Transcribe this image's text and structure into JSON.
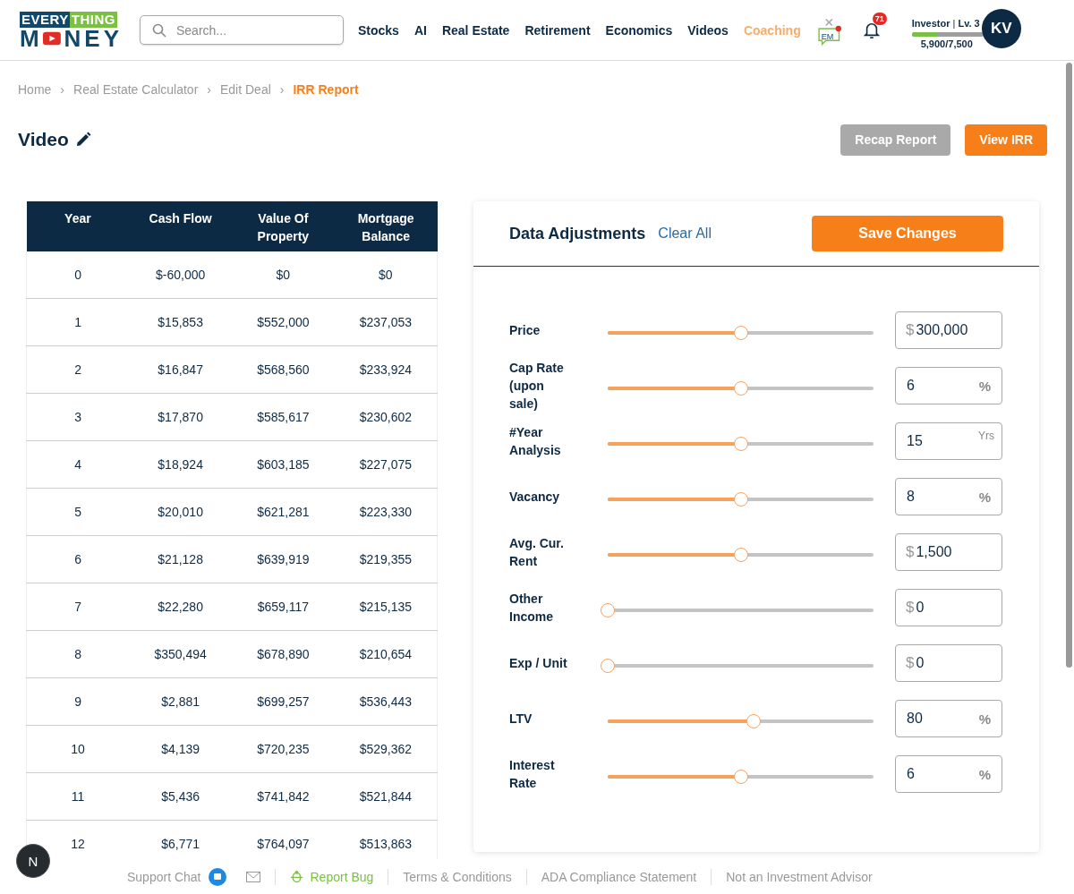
{
  "logo": {
    "top_left": "EVERY",
    "top_right": "THING",
    "bottom_left": "M",
    "bottom_right": "NEY"
  },
  "search": {
    "placeholder": "Search..."
  },
  "nav": [
    {
      "label": "Stocks",
      "selected": false
    },
    {
      "label": "AI",
      "selected": false
    },
    {
      "label": "Real Estate",
      "selected": false
    },
    {
      "label": "Retirement",
      "selected": false
    },
    {
      "label": "Economics",
      "selected": false
    },
    {
      "label": "Videos",
      "selected": false
    },
    {
      "label": "Coaching",
      "selected": true
    }
  ],
  "chat_badge": {
    "label": "EM",
    "unread": true
  },
  "notifications": {
    "count": "71"
  },
  "user": {
    "rank": "**Investor** | **Lv. 3**",
    "level": 0.35,
    "points": "5,900/7,500",
    "initials": "KV"
  },
  "breadcrumb_separator": "›",
  "breadcrumb": [
    {
      "label": "Home",
      "selected": false
    },
    {
      "label": "Real Estate Calculator",
      "selected": false
    },
    {
      "label": "Edit Deal",
      "selected": false
    },
    {
      "label": "IRR Report",
      "selected": true
    }
  ],
  "page_title": "Video",
  "actions": [
    {
      "label": "Recap Report",
      "kind": "secondary"
    },
    {
      "label": "View IRR",
      "kind": "primary"
    }
  ],
  "table": {
    "columns": [
      "Year",
      "Cash Flow",
      "Value Of Property",
      "Mortgage Balance"
    ],
    "rows": [
      [
        "0",
        "$-60,000",
        "$0",
        "$0"
      ],
      [
        "1",
        "$15,853",
        "$552,000",
        "$237,053"
      ],
      [
        "2",
        "$16,847",
        "$568,560",
        "$233,924"
      ],
      [
        "3",
        "$17,870",
        "$585,617",
        "$230,602"
      ],
      [
        "4",
        "$18,924",
        "$603,185",
        "$227,075"
      ],
      [
        "5",
        "$20,010",
        "$621,281",
        "$223,330"
      ],
      [
        "6",
        "$21,128",
        "$639,919",
        "$219,355"
      ],
      [
        "7",
        "$22,280",
        "$659,117",
        "$215,135"
      ],
      [
        "8",
        "$350,494",
        "$678,890",
        "$210,654"
      ],
      [
        "9",
        "$2,881",
        "$699,257",
        "$536,443"
      ],
      [
        "10",
        "$4,139",
        "$720,235",
        "$529,362"
      ],
      [
        "11",
        "$5,436",
        "$741,842",
        "$521,844"
      ],
      [
        "12",
        "$6,771",
        "$764,097",
        "$513,863"
      ]
    ]
  },
  "adjustments": {
    "title": "Data Adjustments",
    "clear": "Clear All",
    "save": "Save Changes",
    "items": [
      {
        "label": "Price",
        "level": 0.5,
        "value": "300,000",
        "prefix": "$"
      },
      {
        "label": "Cap Rate (upon sale)",
        "level": 0.5,
        "value": "6",
        "suffix": "%"
      },
      {
        "label": "#Year Analysis",
        "level": 0.5,
        "value": "15",
        "suffix": "Yrs"
      },
      {
        "label": "Vacancy",
        "level": 0.5,
        "value": "8",
        "suffix": "%"
      },
      {
        "label": "Avg. Cur. Rent",
        "level": 0.5,
        "value": "1,500",
        "prefix": "$"
      },
      {
        "label": "Other Income",
        "level": 0,
        "value": "0",
        "prefix": "$"
      },
      {
        "label": "Exp / Unit",
        "level": 0,
        "value": "0",
        "prefix": "$"
      },
      {
        "label": "LTV",
        "level": 0.55,
        "value": "80",
        "suffix": "%"
      },
      {
        "label": "Interest Rate",
        "level": 0.5,
        "value": "6",
        "suffix": "%"
      }
    ]
  },
  "help_badge": {
    "label": "N"
  },
  "footer": [
    {
      "label": "Support Chat",
      "kind": "chat"
    },
    {
      "kind": "mail"
    },
    {
      "label": "Report Bug",
      "kind": "bug"
    },
    {
      "label": "Terms & Conditions",
      "kind": "link"
    },
    {
      "label": "ADA Compliance Statement",
      "kind": "link"
    },
    {
      "label": "Not an Investment Advisor",
      "kind": "link"
    }
  ]
}
